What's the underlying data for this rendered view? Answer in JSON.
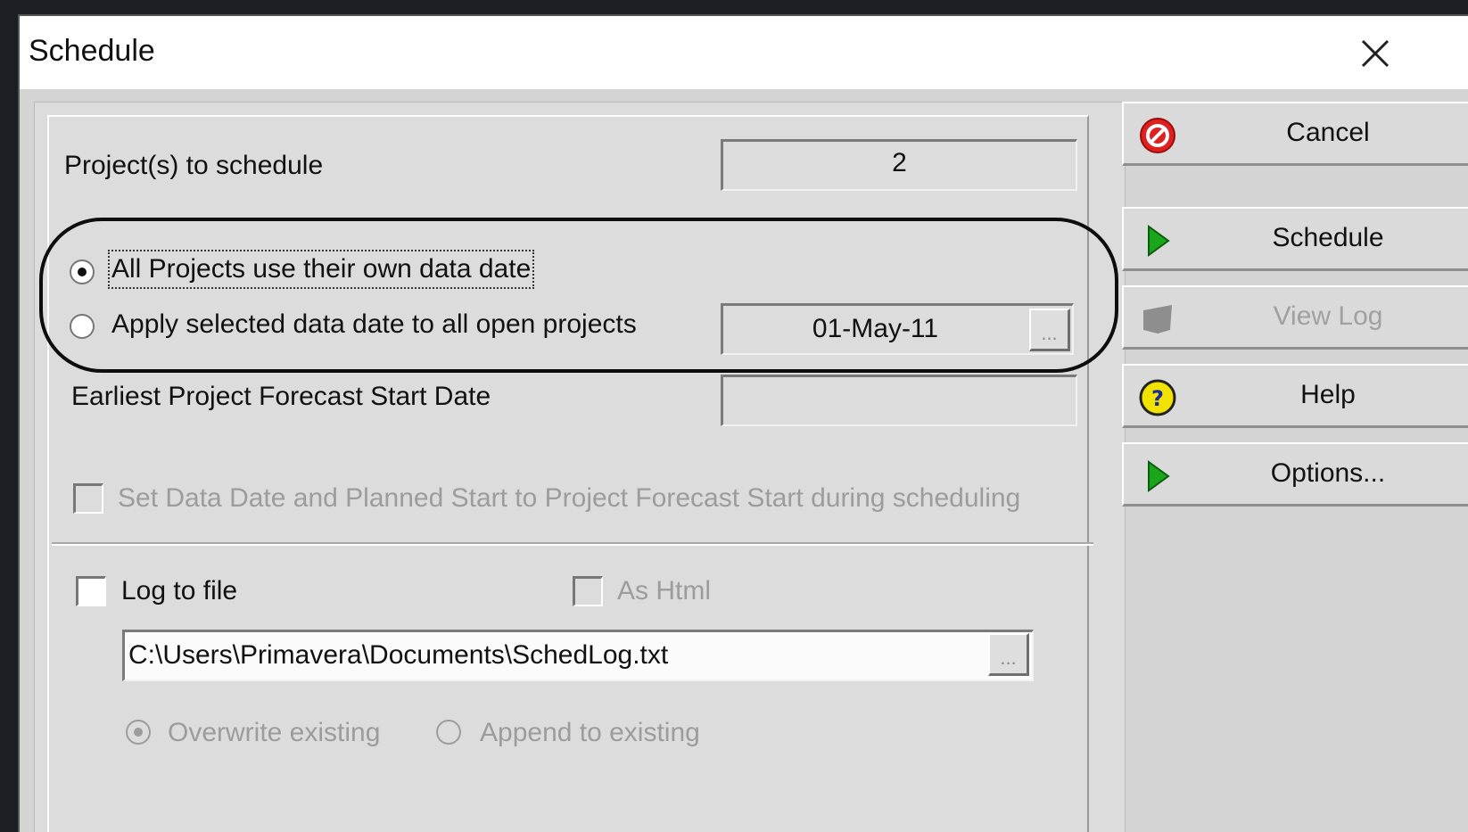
{
  "window": {
    "title": "Schedule"
  },
  "fields": {
    "projects_to_schedule_label": "Project(s) to schedule",
    "projects_to_schedule_value": "2",
    "data_date_value": "01-May-11",
    "earliest_start_label": "Earliest Project Forecast Start Date",
    "earliest_start_value": ""
  },
  "options": {
    "own_data_date": {
      "label": "All Projects use their own data date",
      "selected": true
    },
    "apply_selected": {
      "label": "Apply selected data date to all open projects",
      "selected": false
    },
    "set_data_date": {
      "label": "Set Data Date and Planned Start to Project Forecast Start during scheduling",
      "checked": false,
      "enabled": false
    }
  },
  "log": {
    "log_to_file_label": "Log to file",
    "log_to_file_checked": false,
    "as_html_label": "As Html",
    "as_html_checked": false,
    "file_path": "C:\\Users\\Primavera\\Documents\\SchedLog.txt",
    "overwrite_label": "Overwrite existing",
    "append_label": "Append to existing",
    "overwrite_selected": true
  },
  "ellipsis_label": "...",
  "buttons": {
    "cancel": {
      "label": "Cancel",
      "icon": "cancel-icon"
    },
    "schedule": {
      "label": "Schedule",
      "icon": "play-icon"
    },
    "view_log": {
      "label": "View Log",
      "icon": "view-log-icon",
      "enabled": false
    },
    "help": {
      "label": "Help",
      "icon": "help-icon"
    },
    "options": {
      "label": "Options...",
      "icon": "play-icon"
    }
  },
  "colors": {
    "play_green": "#1aa61a",
    "cancel_red": "#e02020",
    "help_yellow": "#f2e200",
    "disabled_gray": "#9c9c9c"
  }
}
